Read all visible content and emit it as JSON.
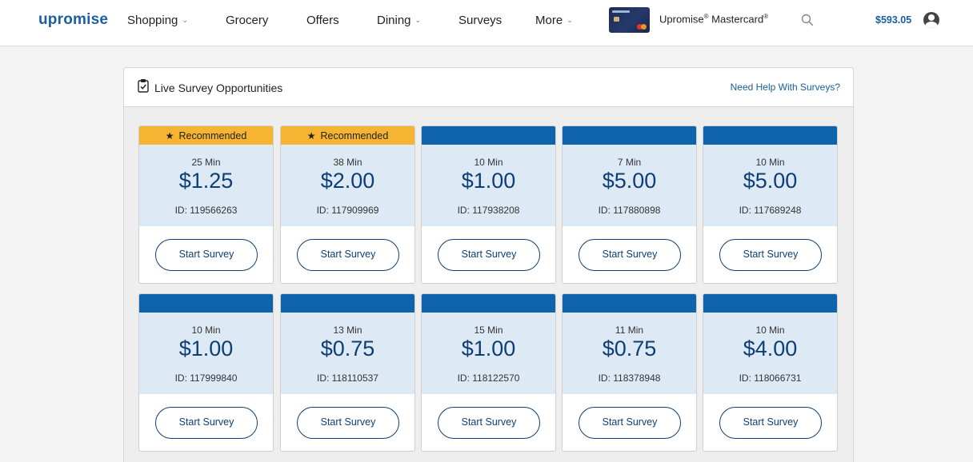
{
  "header": {
    "logo_text": "upromise",
    "nav": [
      {
        "label": "Shopping",
        "dropdown": true
      },
      {
        "label": "Grocery",
        "dropdown": false
      },
      {
        "label": "Offers",
        "dropdown": false
      },
      {
        "label": "Dining",
        "dropdown": true
      },
      {
        "label": "Surveys",
        "dropdown": false
      },
      {
        "label": "More",
        "dropdown": true
      }
    ],
    "card_label": "Upromise",
    "card_label_2": "Mastercard",
    "registered_mark": "®",
    "balance": "$593.05",
    "icons": {
      "search": "search-icon",
      "avatar": "user-avatar-icon",
      "chevron": "chevron-down-icon"
    }
  },
  "panel": {
    "title": "Live Survey Opportunities",
    "help_link": "Need Help With Surveys?",
    "title_icon": "clipboard-check-icon"
  },
  "surveys": [
    {
      "recommended": true,
      "badge": "Recommended",
      "time": "25 Min",
      "reward": "$1.25",
      "id_text": "ID: 119566263",
      "button": "Start Survey"
    },
    {
      "recommended": true,
      "badge": "Recommended",
      "time": "38 Min",
      "reward": "$2.00",
      "id_text": "ID: 117909969",
      "button": "Start Survey"
    },
    {
      "recommended": false,
      "badge": "",
      "time": "10 Min",
      "reward": "$1.00",
      "id_text": "ID: 117938208",
      "button": "Start Survey"
    },
    {
      "recommended": false,
      "badge": "",
      "time": "7 Min",
      "reward": "$5.00",
      "id_text": "ID: 117880898",
      "button": "Start Survey"
    },
    {
      "recommended": false,
      "badge": "",
      "time": "10 Min",
      "reward": "$5.00",
      "id_text": "ID: 117689248",
      "button": "Start Survey"
    },
    {
      "recommended": false,
      "badge": "",
      "time": "10 Min",
      "reward": "$1.00",
      "id_text": "ID: 117999840",
      "button": "Start Survey"
    },
    {
      "recommended": false,
      "badge": "",
      "time": "13 Min",
      "reward": "$0.75",
      "id_text": "ID: 118110537",
      "button": "Start Survey"
    },
    {
      "recommended": false,
      "badge": "",
      "time": "15 Min",
      "reward": "$1.00",
      "id_text": "ID: 118122570",
      "button": "Start Survey"
    },
    {
      "recommended": false,
      "badge": "",
      "time": "11 Min",
      "reward": "$0.75",
      "id_text": "ID: 118378948",
      "button": "Start Survey"
    },
    {
      "recommended": false,
      "badge": "",
      "time": "10 Min",
      "reward": "$4.00",
      "id_text": "ID: 118066731",
      "button": "Start Survey"
    }
  ],
  "colors": {
    "brand_blue": "#1a5fa3",
    "band_blue": "#0f63ad",
    "recommended_gold": "#f6b433",
    "info_bg": "#dde9f4",
    "reward_text": "#0d3f74"
  }
}
